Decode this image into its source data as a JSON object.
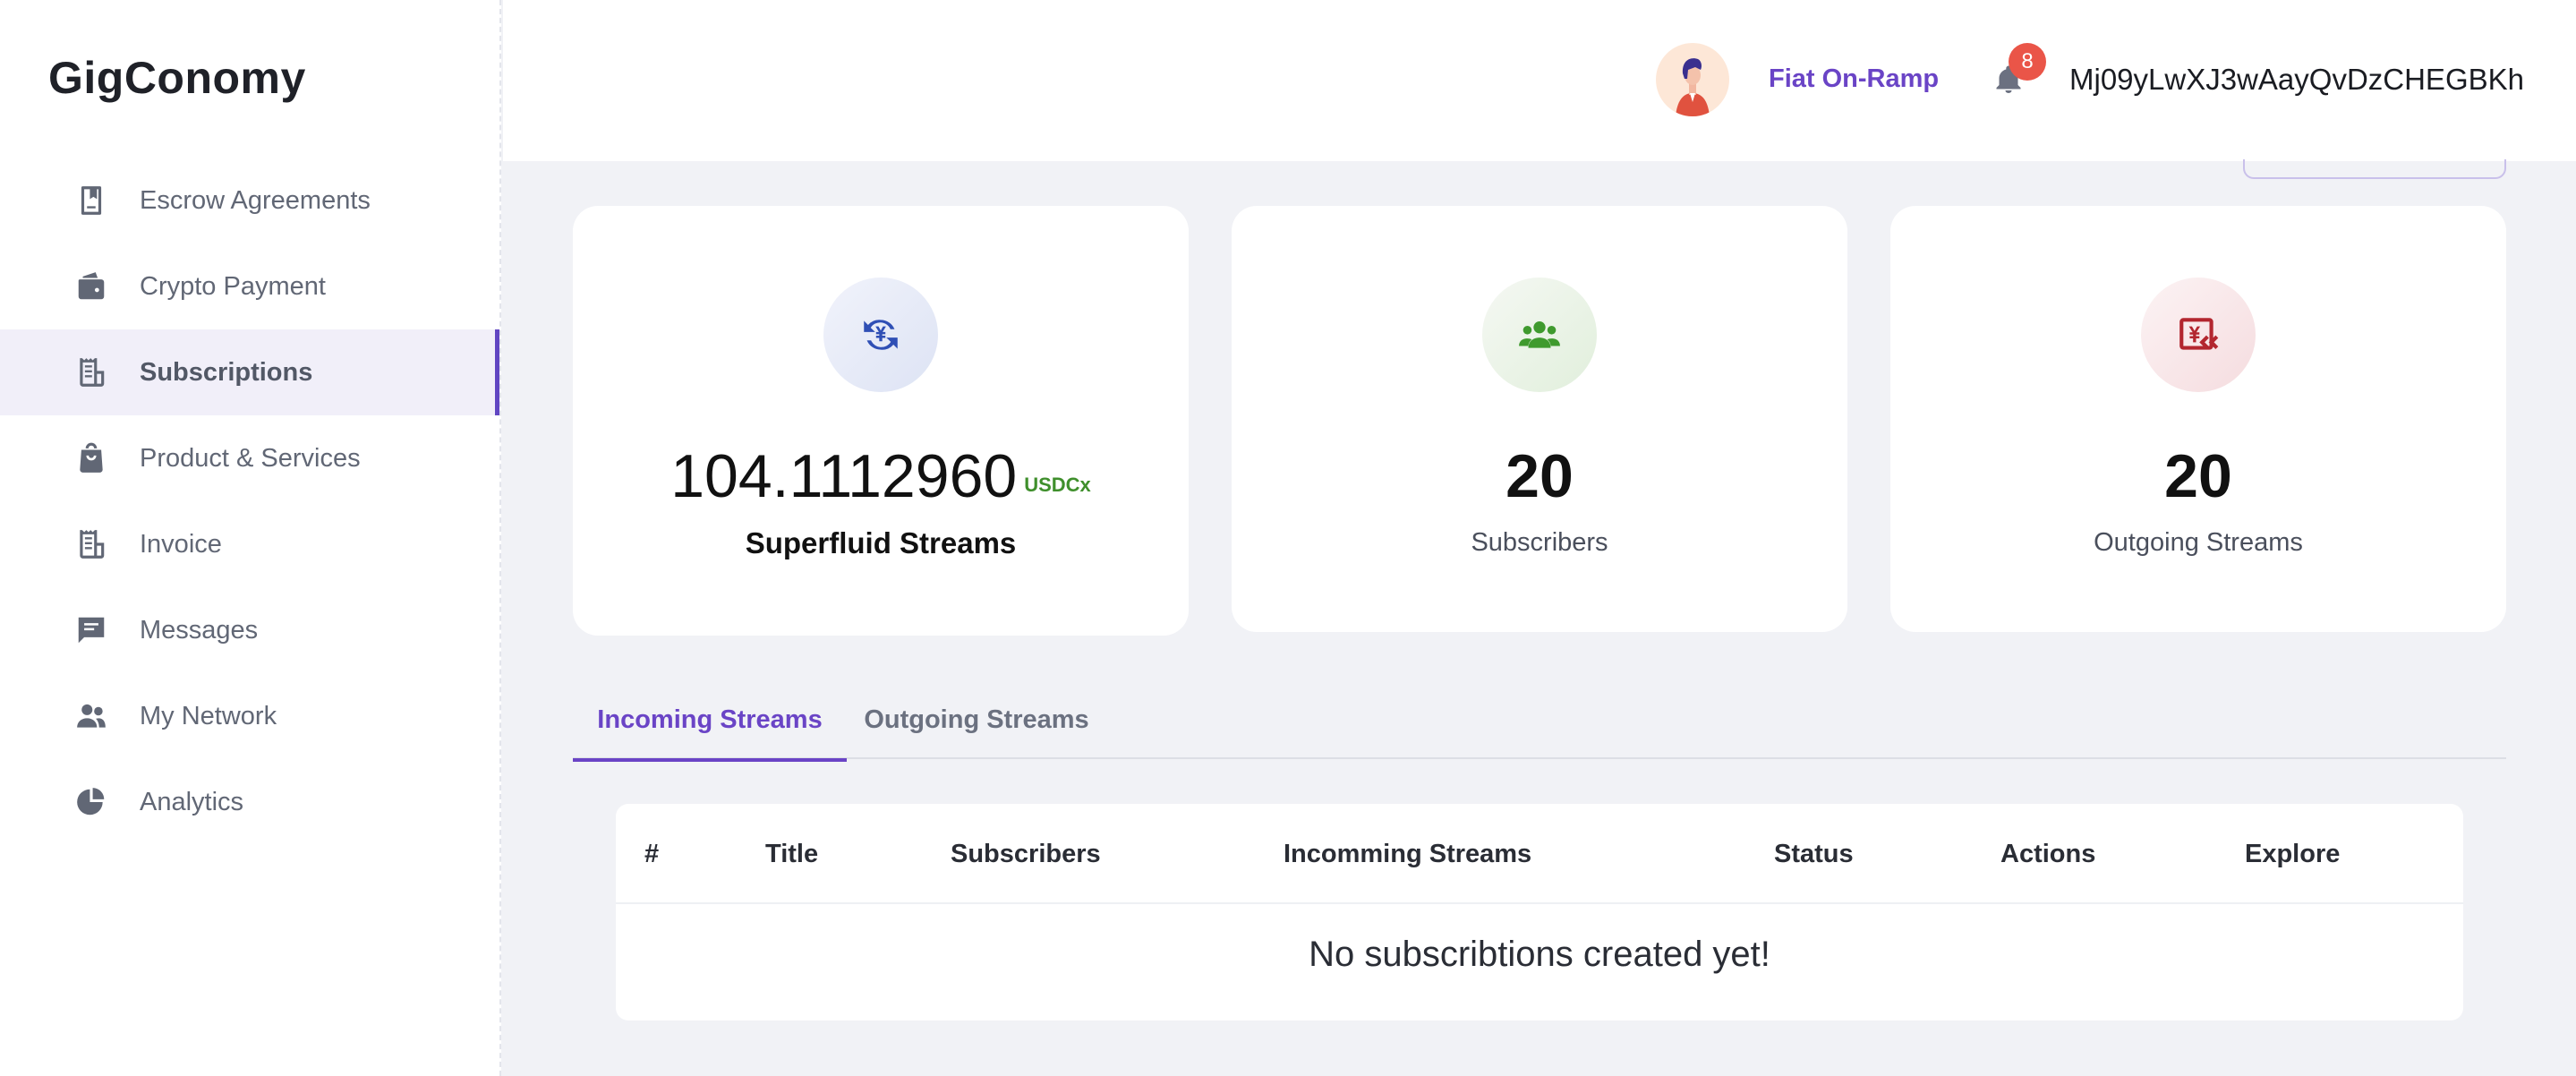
{
  "app": {
    "logo": "GigConomy"
  },
  "sidebar": {
    "items": [
      {
        "label": "Escrow Agreements",
        "icon": "escrow-book-icon"
      },
      {
        "label": "Crypto Payment",
        "icon": "wallet-icon"
      },
      {
        "label": "Subscriptions",
        "icon": "receipt-icon",
        "active": true
      },
      {
        "label": "Product & Services",
        "icon": "shopping-bag-icon"
      },
      {
        "label": "Invoice",
        "icon": "invoice-icon"
      },
      {
        "label": "Messages",
        "icon": "message-icon"
      },
      {
        "label": "My Network",
        "icon": "users-icon"
      },
      {
        "label": "Analytics",
        "icon": "pie-chart-icon"
      }
    ]
  },
  "header": {
    "fiat_link": "Fiat On-Ramp",
    "notifications_count": "8",
    "wallet_address": "Mj09yLwXJ3wAayQvDzCHEGBKh"
  },
  "stats": {
    "streams": {
      "value": "104.1112960",
      "unit": "USDCx",
      "label": "Superfluid Streams",
      "icon": "currency-exchange-icon",
      "color": "#2f4fb5"
    },
    "subscribers": {
      "value": "20",
      "label": "Subscribers",
      "icon": "group-icon",
      "color": "#3f9a2e"
    },
    "outgoing": {
      "value": "20",
      "label": "Outgoing Streams",
      "icon": "outgoing-payment-icon",
      "color": "#b3262f"
    }
  },
  "tabs": [
    {
      "label": "Incoming Streams",
      "active": true
    },
    {
      "label": "Outgoing Streams",
      "active": false
    }
  ],
  "table": {
    "columns": [
      "#",
      "Title",
      "Subscribers",
      "Incomming Streams",
      "Status",
      "Actions",
      "Explore"
    ],
    "empty_message": "No subscribtions created yet!"
  },
  "colors": {
    "accent": "#6a44c6",
    "badge": "#ea5548",
    "background": "#f1f2f6"
  }
}
